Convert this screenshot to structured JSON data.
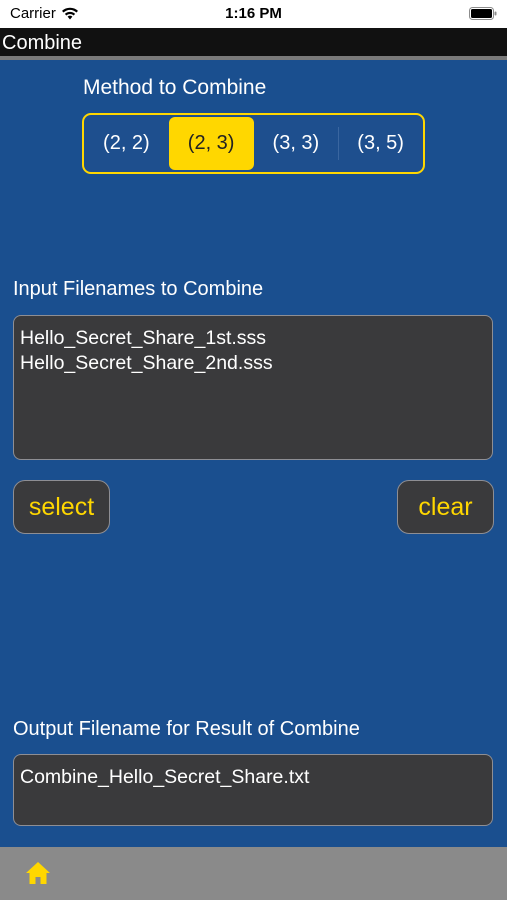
{
  "status": {
    "carrier": "Carrier",
    "time": "1:16 PM",
    "icons": [
      "wifi-icon",
      "battery-icon"
    ]
  },
  "nav": {
    "title": "Combine"
  },
  "method": {
    "label": "Method to Combine",
    "segments": [
      "(2, 2)",
      "(2, 3)",
      "(3, 3)",
      "(3, 5)"
    ],
    "selected": "(2, 3)",
    "accent_color": "#ffd700"
  },
  "input": {
    "label": "Input Filenames to Combine",
    "files": [
      "Hello_Secret_Share_1st.sss",
      "Hello_Secret_Share_2nd.sss"
    ]
  },
  "buttons": {
    "select": "select",
    "clear": "clear"
  },
  "output": {
    "label": "Output Filename for Result of Combine",
    "filename": "Combine_Hello_Secret_Share.txt"
  },
  "tabbar": {
    "icon": "home-icon",
    "icon_color": "#ffd700"
  },
  "colors": {
    "background": "#1a4f8f",
    "field": "#3a3a3c"
  }
}
